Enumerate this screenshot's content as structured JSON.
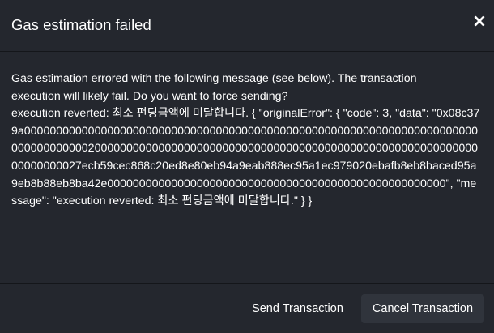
{
  "dialog": {
    "title": "Gas estimation failed",
    "close_icon": "close-icon",
    "message_line_1": "Gas estimation errored with the following message (see below). The transaction",
    "message_line_2": "execution will likely fail. Do you want to force sending?",
    "error_text": "execution reverted: 최소 펀딩금액에 미달합니다. { \"originalError\": { \"code\": 3, \"data\": \"0x08c379a00000000000000000000000000000000000000000000000000000000000000000000000000000000000200000000000000000000000000000000000000000000000000000000000000000000027ecb59cec868c20ed8e80eb94a9eab888ec95a1ec979020ebafb8eb8baced95a9eb8b88eb8ba42e00000000000000000000000000000000000000000000000000000\", \"message\": \"execution reverted: 최소 펀딩금액에 미달합니다.\" } }"
  },
  "footer": {
    "send_label": "Send Transaction",
    "cancel_label": "Cancel Transaction"
  },
  "colors": {
    "background": "#24272e",
    "text": "#ffffff",
    "cancel_button": "#30343c"
  }
}
